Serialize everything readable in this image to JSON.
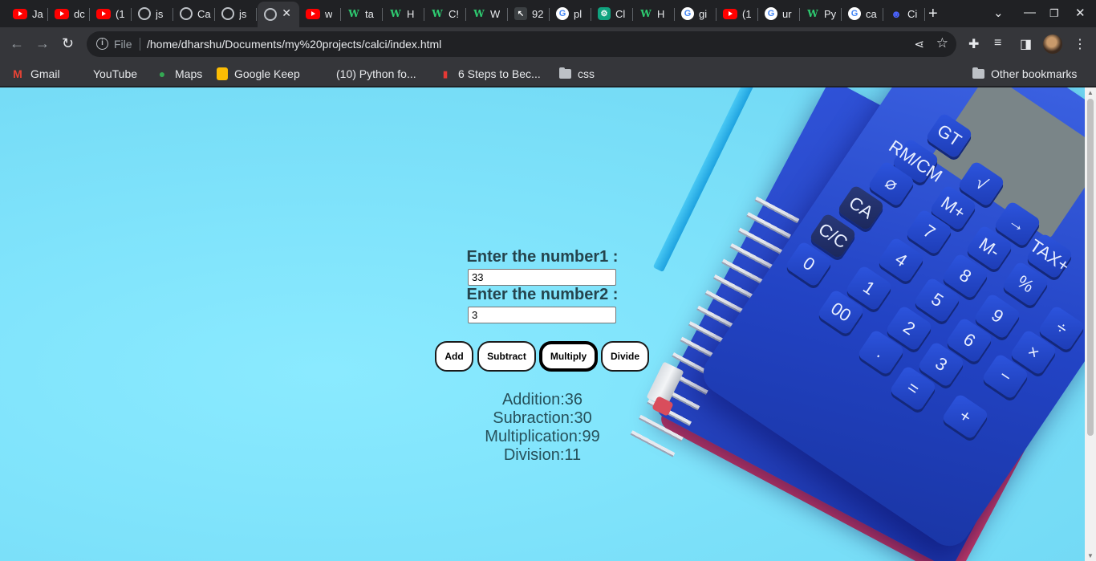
{
  "browser": {
    "tabs": [
      {
        "icon": "youtube",
        "label": "Ja"
      },
      {
        "icon": "youtube",
        "label": "dc"
      },
      {
        "icon": "youtube",
        "label": "(1"
      },
      {
        "icon": "globe",
        "label": "js"
      },
      {
        "icon": "globe",
        "label": "Ca"
      },
      {
        "icon": "globe",
        "label": "js"
      },
      {
        "icon": "globe",
        "label": "",
        "active": true
      },
      {
        "icon": "youtube",
        "label": "w"
      },
      {
        "icon": "w3schools",
        "label": "ta"
      },
      {
        "icon": "w3schools",
        "label": "H"
      },
      {
        "icon": "w3schools",
        "label": "C!"
      },
      {
        "icon": "w3schools",
        "label": "W"
      },
      {
        "icon": "cursor",
        "label": "92"
      },
      {
        "icon": "google",
        "label": "pl"
      },
      {
        "icon": "chatgpt",
        "label": "Cl"
      },
      {
        "icon": "w3schools",
        "label": "H"
      },
      {
        "icon": "google",
        "label": "gi"
      },
      {
        "icon": "youtube",
        "label": "(1"
      },
      {
        "icon": "google",
        "label": "ur"
      },
      {
        "icon": "w3schools",
        "label": "Py"
      },
      {
        "icon": "google",
        "label": "ca"
      },
      {
        "icon": "bot",
        "label": "Ci"
      }
    ],
    "omnibox": {
      "scheme_label": "File",
      "url": "/home/dharshu/Documents/my%20projects/calci/index.html"
    },
    "bookmarks": [
      {
        "icon": "gmail",
        "label": "Gmail"
      },
      {
        "icon": "youtube",
        "label": "YouTube"
      },
      {
        "icon": "maps",
        "label": "Maps"
      },
      {
        "icon": "keep",
        "label": "Google Keep"
      },
      {
        "icon": "youtube",
        "label": "(10) Python fo..."
      },
      {
        "icon": "steps",
        "label": "6 Steps to Bec..."
      },
      {
        "icon": "folder",
        "label": "css"
      }
    ],
    "other_bookmarks": "Other bookmarks"
  },
  "calculator": {
    "label1": "Enter the number1 :",
    "value1": "33",
    "label2": "Enter the number2 :",
    "value2": "3",
    "buttons": {
      "add": "Add",
      "subtract": "Subtract",
      "multiply": "Multiply",
      "divide": "Divide"
    },
    "focused_button": "multiply",
    "results": {
      "addition": "Addition:36",
      "subtraction": "Subraction:30",
      "multiplication": "Multiplication:99",
      "division": "Division:11"
    }
  },
  "background_keys": [
    "GT",
    "RM/CM",
    "⌀",
    "√",
    "CA",
    "M+",
    "→",
    "C/C",
    "7",
    "M-",
    "TAX+",
    "0",
    "4",
    "8",
    "%",
    "1",
    "5",
    "9",
    "00",
    "2",
    "6",
    "÷",
    ".",
    "3",
    "−",
    "×",
    "=",
    "+"
  ]
}
